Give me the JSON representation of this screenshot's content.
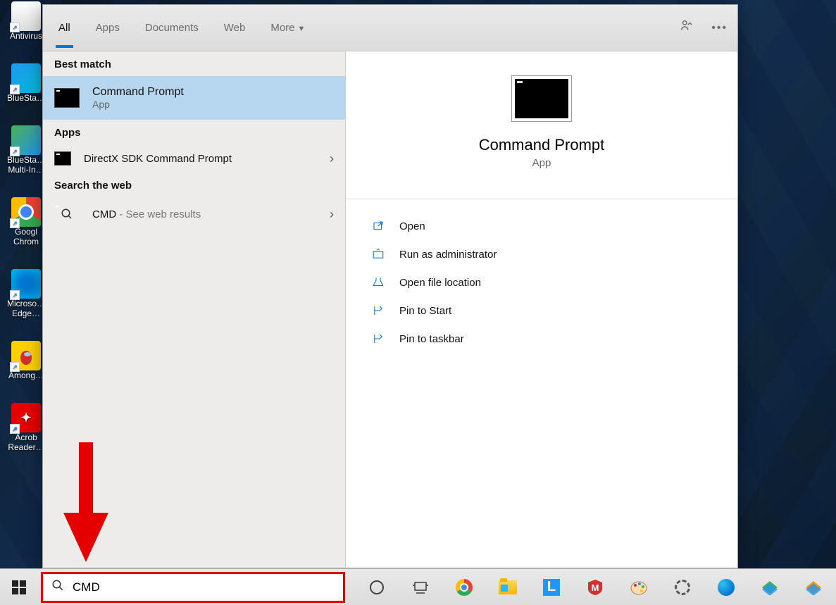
{
  "desktop_icons": [
    "Antivirus",
    "BlueSta…",
    "BlueSta… Multi-In…",
    "Googl Chrom",
    "Microso… Edge…",
    "Among…",
    "Acrob Reader…"
  ],
  "tabs": {
    "all": "All",
    "apps": "Apps",
    "documents": "Documents",
    "web": "Web",
    "more": "More"
  },
  "left": {
    "best_match_h": "Best match",
    "best": {
      "title": "Command Prompt",
      "sub": "App"
    },
    "apps_h": "Apps",
    "app_result": "DirectX SDK Command Prompt",
    "web_h": "Search the web",
    "web_result": "CMD",
    "web_suffix": " - See web results"
  },
  "right": {
    "title": "Command Prompt",
    "sub": "App",
    "actions": [
      "Open",
      "Run as administrator",
      "Open file location",
      "Pin to Start",
      "Pin to taskbar"
    ]
  },
  "search_value": "CMD"
}
